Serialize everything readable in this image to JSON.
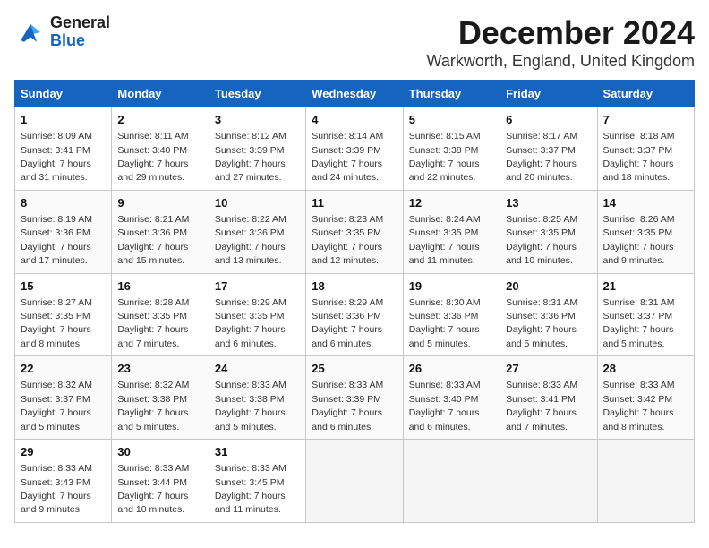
{
  "header": {
    "logo_general": "General",
    "logo_blue": "Blue",
    "title": "December 2024",
    "subtitle": "Warkworth, England, United Kingdom"
  },
  "weekdays": [
    "Sunday",
    "Monday",
    "Tuesday",
    "Wednesday",
    "Thursday",
    "Friday",
    "Saturday"
  ],
  "weeks": [
    [
      {
        "day": 1,
        "sunrise": "8:09 AM",
        "sunset": "3:41 PM",
        "daylight": "7 hours and 31 minutes."
      },
      {
        "day": 2,
        "sunrise": "8:11 AM",
        "sunset": "3:40 PM",
        "daylight": "7 hours and 29 minutes."
      },
      {
        "day": 3,
        "sunrise": "8:12 AM",
        "sunset": "3:39 PM",
        "daylight": "7 hours and 27 minutes."
      },
      {
        "day": 4,
        "sunrise": "8:14 AM",
        "sunset": "3:39 PM",
        "daylight": "7 hours and 24 minutes."
      },
      {
        "day": 5,
        "sunrise": "8:15 AM",
        "sunset": "3:38 PM",
        "daylight": "7 hours and 22 minutes."
      },
      {
        "day": 6,
        "sunrise": "8:17 AM",
        "sunset": "3:37 PM",
        "daylight": "7 hours and 20 minutes."
      },
      {
        "day": 7,
        "sunrise": "8:18 AM",
        "sunset": "3:37 PM",
        "daylight": "7 hours and 18 minutes."
      }
    ],
    [
      {
        "day": 8,
        "sunrise": "8:19 AM",
        "sunset": "3:36 PM",
        "daylight": "7 hours and 17 minutes."
      },
      {
        "day": 9,
        "sunrise": "8:21 AM",
        "sunset": "3:36 PM",
        "daylight": "7 hours and 15 minutes."
      },
      {
        "day": 10,
        "sunrise": "8:22 AM",
        "sunset": "3:36 PM",
        "daylight": "7 hours and 13 minutes."
      },
      {
        "day": 11,
        "sunrise": "8:23 AM",
        "sunset": "3:35 PM",
        "daylight": "7 hours and 12 minutes."
      },
      {
        "day": 12,
        "sunrise": "8:24 AM",
        "sunset": "3:35 PM",
        "daylight": "7 hours and 11 minutes."
      },
      {
        "day": 13,
        "sunrise": "8:25 AM",
        "sunset": "3:35 PM",
        "daylight": "7 hours and 10 minutes."
      },
      {
        "day": 14,
        "sunrise": "8:26 AM",
        "sunset": "3:35 PM",
        "daylight": "7 hours and 9 minutes."
      }
    ],
    [
      {
        "day": 15,
        "sunrise": "8:27 AM",
        "sunset": "3:35 PM",
        "daylight": "7 hours and 8 minutes."
      },
      {
        "day": 16,
        "sunrise": "8:28 AM",
        "sunset": "3:35 PM",
        "daylight": "7 hours and 7 minutes."
      },
      {
        "day": 17,
        "sunrise": "8:29 AM",
        "sunset": "3:35 PM",
        "daylight": "7 hours and 6 minutes."
      },
      {
        "day": 18,
        "sunrise": "8:29 AM",
        "sunset": "3:36 PM",
        "daylight": "7 hours and 6 minutes."
      },
      {
        "day": 19,
        "sunrise": "8:30 AM",
        "sunset": "3:36 PM",
        "daylight": "7 hours and 5 minutes."
      },
      {
        "day": 20,
        "sunrise": "8:31 AM",
        "sunset": "3:36 PM",
        "daylight": "7 hours and 5 minutes."
      },
      {
        "day": 21,
        "sunrise": "8:31 AM",
        "sunset": "3:37 PM",
        "daylight": "7 hours and 5 minutes."
      }
    ],
    [
      {
        "day": 22,
        "sunrise": "8:32 AM",
        "sunset": "3:37 PM",
        "daylight": "7 hours and 5 minutes."
      },
      {
        "day": 23,
        "sunrise": "8:32 AM",
        "sunset": "3:38 PM",
        "daylight": "7 hours and 5 minutes."
      },
      {
        "day": 24,
        "sunrise": "8:33 AM",
        "sunset": "3:38 PM",
        "daylight": "7 hours and 5 minutes."
      },
      {
        "day": 25,
        "sunrise": "8:33 AM",
        "sunset": "3:39 PM",
        "daylight": "7 hours and 6 minutes."
      },
      {
        "day": 26,
        "sunrise": "8:33 AM",
        "sunset": "3:40 PM",
        "daylight": "7 hours and 6 minutes."
      },
      {
        "day": 27,
        "sunrise": "8:33 AM",
        "sunset": "3:41 PM",
        "daylight": "7 hours and 7 minutes."
      },
      {
        "day": 28,
        "sunrise": "8:33 AM",
        "sunset": "3:42 PM",
        "daylight": "7 hours and 8 minutes."
      }
    ],
    [
      {
        "day": 29,
        "sunrise": "8:33 AM",
        "sunset": "3:43 PM",
        "daylight": "7 hours and 9 minutes."
      },
      {
        "day": 30,
        "sunrise": "8:33 AM",
        "sunset": "3:44 PM",
        "daylight": "7 hours and 10 minutes."
      },
      {
        "day": 31,
        "sunrise": "8:33 AM",
        "sunset": "3:45 PM",
        "daylight": "7 hours and 11 minutes."
      },
      null,
      null,
      null,
      null
    ]
  ],
  "labels": {
    "sunrise": "Sunrise:",
    "sunset": "Sunset:",
    "daylight": "Daylight:"
  }
}
